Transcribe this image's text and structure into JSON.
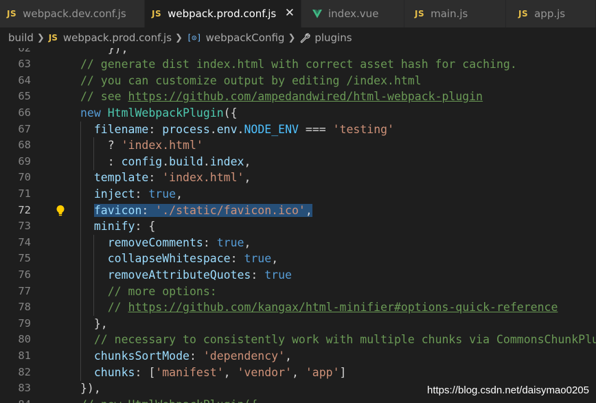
{
  "tabs": [
    {
      "icon": "JS",
      "label": "webpack.dev.conf.js",
      "active": false
    },
    {
      "icon": "JS",
      "label": "webpack.prod.conf.js",
      "active": true,
      "close": "✕"
    },
    {
      "icon": "vue-icon",
      "label": "index.vue",
      "active": false
    },
    {
      "icon": "JS",
      "label": "main.js",
      "active": false
    },
    {
      "icon": "JS",
      "label": "app.js",
      "active": false
    }
  ],
  "breadcrumb": {
    "folder": "build",
    "file_icon": "JS",
    "file": "webpack.prod.conf.js",
    "object_icon": "[⊙]",
    "object": "webpackConfig",
    "property": "plugins"
  },
  "current_line": 72,
  "lines": [
    {
      "n": "62",
      "t": [
        {
          "c": "pl",
          "s": "    }),"
        }
      ]
    },
    {
      "n": "63",
      "t": [
        {
          "c": "cm",
          "s": "// generate dist index.html with correct asset hash for caching."
        }
      ]
    },
    {
      "n": "64",
      "t": [
        {
          "c": "cm",
          "s": "// you can customize output by editing /index.html"
        }
      ]
    },
    {
      "n": "65",
      "t": [
        {
          "c": "cm",
          "s": "// see "
        },
        {
          "c": "link",
          "s": "https://github.com/ampedandwired/html-webpack-plugin"
        }
      ]
    },
    {
      "n": "66",
      "t": [
        {
          "c": "kw",
          "s": "new"
        },
        {
          "c": "pl",
          "s": " "
        },
        {
          "c": "cls",
          "s": "HtmlWebpackPlugin"
        },
        {
          "c": "pl",
          "s": "({"
        }
      ]
    },
    {
      "n": "67",
      "t": [
        {
          "c": "pl",
          "s": "  "
        },
        {
          "c": "prop",
          "s": "filename"
        },
        {
          "c": "pl",
          "s": ": "
        },
        {
          "c": "prop",
          "s": "process"
        },
        {
          "c": "pl",
          "s": "."
        },
        {
          "c": "prop",
          "s": "env"
        },
        {
          "c": "pl",
          "s": "."
        },
        {
          "c": "const",
          "s": "NODE_ENV"
        },
        {
          "c": "pl",
          "s": " === "
        },
        {
          "c": "str",
          "s": "'testing'"
        }
      ]
    },
    {
      "n": "68",
      "t": [
        {
          "c": "pl",
          "s": "    ? "
        },
        {
          "c": "str",
          "s": "'index.html'"
        }
      ]
    },
    {
      "n": "69",
      "t": [
        {
          "c": "pl",
          "s": "    : "
        },
        {
          "c": "prop",
          "s": "config"
        },
        {
          "c": "pl",
          "s": "."
        },
        {
          "c": "prop",
          "s": "build"
        },
        {
          "c": "pl",
          "s": "."
        },
        {
          "c": "prop",
          "s": "index"
        },
        {
          "c": "pl",
          "s": ","
        }
      ]
    },
    {
      "n": "70",
      "t": [
        {
          "c": "pl",
          "s": "  "
        },
        {
          "c": "prop",
          "s": "template"
        },
        {
          "c": "pl",
          "s": ": "
        },
        {
          "c": "str",
          "s": "'index.html'"
        },
        {
          "c": "pl",
          "s": ","
        }
      ]
    },
    {
      "n": "71",
      "t": [
        {
          "c": "pl",
          "s": "  "
        },
        {
          "c": "prop",
          "s": "inject"
        },
        {
          "c": "pl",
          "s": ": "
        },
        {
          "c": "kw",
          "s": "true"
        },
        {
          "c": "pl",
          "s": ","
        }
      ]
    },
    {
      "n": "72",
      "t": [
        {
          "c": "pl",
          "s": "  "
        },
        {
          "c": "prop sel",
          "s": "favicon"
        },
        {
          "c": "pl sel",
          "s": ": "
        },
        {
          "c": "str sel",
          "s": "'./static/favicon.ico'"
        },
        {
          "c": "pl sel",
          "s": ","
        }
      ]
    },
    {
      "n": "73",
      "t": [
        {
          "c": "pl",
          "s": "  "
        },
        {
          "c": "prop",
          "s": "minify"
        },
        {
          "c": "pl",
          "s": ": {"
        }
      ]
    },
    {
      "n": "74",
      "t": [
        {
          "c": "pl",
          "s": "    "
        },
        {
          "c": "prop",
          "s": "removeComments"
        },
        {
          "c": "pl",
          "s": ": "
        },
        {
          "c": "kw",
          "s": "true"
        },
        {
          "c": "pl",
          "s": ","
        }
      ]
    },
    {
      "n": "75",
      "t": [
        {
          "c": "pl",
          "s": "    "
        },
        {
          "c": "prop",
          "s": "collapseWhitespace"
        },
        {
          "c": "pl",
          "s": ": "
        },
        {
          "c": "kw",
          "s": "true"
        },
        {
          "c": "pl",
          "s": ","
        }
      ]
    },
    {
      "n": "76",
      "t": [
        {
          "c": "pl",
          "s": "    "
        },
        {
          "c": "prop",
          "s": "removeAttributeQuotes"
        },
        {
          "c": "pl",
          "s": ": "
        },
        {
          "c": "kw",
          "s": "true"
        }
      ]
    },
    {
      "n": "77",
      "t": [
        {
          "c": "pl",
          "s": "    "
        },
        {
          "c": "cm",
          "s": "// more options:"
        }
      ]
    },
    {
      "n": "78",
      "t": [
        {
          "c": "pl",
          "s": "    "
        },
        {
          "c": "cm",
          "s": "// "
        },
        {
          "c": "link",
          "s": "https://github.com/kangax/html-minifier#options-quick-reference"
        }
      ]
    },
    {
      "n": "79",
      "t": [
        {
          "c": "pl",
          "s": "  },"
        }
      ]
    },
    {
      "n": "80",
      "t": [
        {
          "c": "pl",
          "s": "  "
        },
        {
          "c": "cm",
          "s": "// necessary to consistently work with multiple chunks via CommonsChunkPlugin"
        }
      ]
    },
    {
      "n": "81",
      "t": [
        {
          "c": "pl",
          "s": "  "
        },
        {
          "c": "prop",
          "s": "chunksSortMode"
        },
        {
          "c": "pl",
          "s": ": "
        },
        {
          "c": "str",
          "s": "'dependency'"
        },
        {
          "c": "pl",
          "s": ","
        }
      ]
    },
    {
      "n": "82",
      "t": [
        {
          "c": "pl",
          "s": "  "
        },
        {
          "c": "prop",
          "s": "chunks"
        },
        {
          "c": "pl",
          "s": ": ["
        },
        {
          "c": "str",
          "s": "'manifest'"
        },
        {
          "c": "pl",
          "s": ", "
        },
        {
          "c": "str",
          "s": "'vendor'"
        },
        {
          "c": "pl",
          "s": ", "
        },
        {
          "c": "str",
          "s": "'app'"
        },
        {
          "c": "pl",
          "s": "]"
        }
      ]
    },
    {
      "n": "83",
      "t": [
        {
          "c": "pl",
          "s": "}),"
        }
      ]
    },
    {
      "n": "84",
      "t": [
        {
          "c": "cm",
          "s": "// new HtmlWebpackPlugin({"
        }
      ]
    }
  ],
  "watermark": "https://blog.csdn.net/daisymao0205",
  "colors": {
    "background": "#1e1e1e",
    "selection": "#264f78",
    "comment": "#6a9955",
    "string": "#ce9178",
    "keyword": "#569cd6",
    "property": "#9cdcfe"
  }
}
